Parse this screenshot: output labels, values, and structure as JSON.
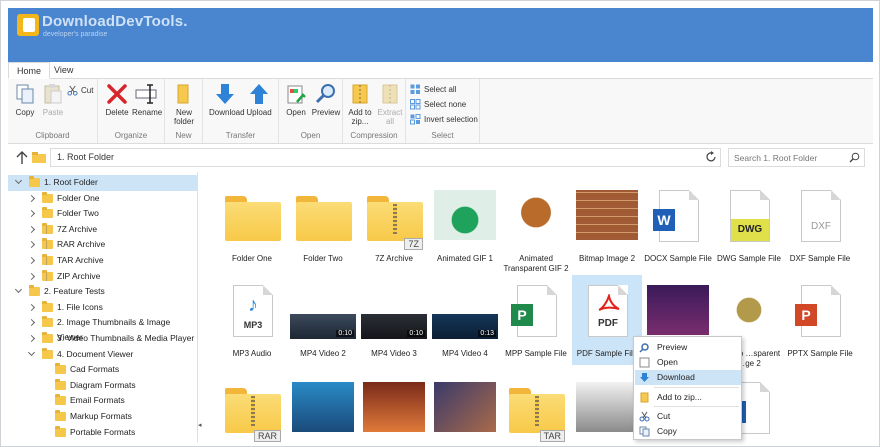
{
  "brand": {
    "name": "DownloadDevTools.",
    "tagline": "developer's paradise"
  },
  "tabs": [
    {
      "label": "Home"
    },
    {
      "label": "View"
    }
  ],
  "ribbon": {
    "groups": [
      {
        "label": "Clipboard",
        "buttons": [
          {
            "label": "Copy",
            "icon": "copy-icon"
          },
          {
            "label": "Paste",
            "icon": "paste-icon",
            "disabled": true
          },
          {
            "label": "Cut",
            "icon": "cut-icon"
          }
        ]
      },
      {
        "label": "Organize",
        "buttons": [
          {
            "label": "Delete",
            "icon": "delete-icon"
          },
          {
            "label": "Rename",
            "icon": "rename-icon"
          }
        ]
      },
      {
        "label": "New",
        "buttons": [
          {
            "label": "New folder",
            "icon": "new-folder-icon"
          }
        ]
      },
      {
        "label": "Transfer",
        "buttons": [
          {
            "label": "Download",
            "icon": "download-icon"
          },
          {
            "label": "Upload",
            "icon": "upload-icon"
          }
        ]
      },
      {
        "label": "Open",
        "buttons": [
          {
            "label": "Open",
            "icon": "open-icon"
          },
          {
            "label": "Preview",
            "icon": "preview-icon"
          }
        ]
      },
      {
        "label": "Compression",
        "buttons": [
          {
            "label": "Add to zip...",
            "icon": "add-zip-icon"
          },
          {
            "label": "Extract all",
            "icon": "extract-icon",
            "disabled": true
          }
        ]
      },
      {
        "label": "Select",
        "buttons": [
          {
            "label": "Select all",
            "icon": "select-all-icon"
          },
          {
            "label": "Select none",
            "icon": "select-none-icon"
          },
          {
            "label": "Invert selection",
            "icon": "invert-selection-icon"
          }
        ]
      }
    ]
  },
  "address": {
    "path": "1. Root Folder",
    "search_placeholder": "Search 1. Root Folder"
  },
  "tree": [
    {
      "label": "1. Root Folder",
      "level": 0,
      "expanded": true,
      "selected": true
    },
    {
      "label": "Folder One",
      "level": 1
    },
    {
      "label": "Folder Two",
      "level": 1
    },
    {
      "label": "7Z Archive",
      "level": 1,
      "zip": true
    },
    {
      "label": "RAR Archive",
      "level": 1,
      "zip": true
    },
    {
      "label": "TAR Archive",
      "level": 1,
      "zip": true
    },
    {
      "label": "ZIP Archive",
      "level": 1,
      "zip": true
    },
    {
      "label": "2. Feature Tests",
      "level": 0,
      "expanded": true
    },
    {
      "label": "1. File Icons",
      "level": 1
    },
    {
      "label": "2. Image Thumbnails & Image Viewer",
      "level": 1
    },
    {
      "label": "3. Video Thumbnails & Media Player",
      "level": 1
    },
    {
      "label": "4. Document Viewer",
      "level": 1,
      "expanded": true
    },
    {
      "label": "Cad Formats",
      "level": 2,
      "leaf": true
    },
    {
      "label": "Diagram Formats",
      "level": 2,
      "leaf": true
    },
    {
      "label": "Email Formats",
      "level": 2,
      "leaf": true
    },
    {
      "label": "Markup Formats",
      "level": 2,
      "leaf": true
    },
    {
      "label": "Portable Formats",
      "level": 2,
      "leaf": true
    }
  ],
  "items": [
    {
      "label": "Folder One",
      "kind": "folder"
    },
    {
      "label": "Folder Two",
      "kind": "folder"
    },
    {
      "label": "7Z Archive",
      "kind": "archive",
      "tag": "7Z"
    },
    {
      "label": "Animated GIF 1",
      "kind": "image"
    },
    {
      "label": "Animated Transparent GIF 2",
      "kind": "image"
    },
    {
      "label": "Bitmap Image 2",
      "kind": "image"
    },
    {
      "label": "DOCX Sample File",
      "kind": "doc",
      "badge": "W"
    },
    {
      "label": "DWG Sample File",
      "kind": "doc",
      "badge": "DWG"
    },
    {
      "label": "DXF Sample File",
      "kind": "doc",
      "badge": "DXF"
    },
    {
      "label": "MP3 Audio",
      "kind": "doc",
      "badge": "MP3"
    },
    {
      "label": "MP4 Video 2",
      "kind": "video",
      "time": "0:10"
    },
    {
      "label": "MP4 Video 3",
      "kind": "video",
      "time": "0:10"
    },
    {
      "label": "MP4 Video 4",
      "kind": "video",
      "time": "0:13"
    },
    {
      "label": "MPP Sample File",
      "kind": "doc",
      "badge": "P"
    },
    {
      "label": "PDF Sample File",
      "kind": "doc",
      "badge": "PDF",
      "selected": true
    },
    {
      "label": "",
      "kind": "image"
    },
    {
      "label": "…shop …sparent …ge 2",
      "kind": "image"
    },
    {
      "label": "PPTX Sample File",
      "kind": "doc",
      "badge": "P"
    },
    {
      "label": "",
      "kind": "archive",
      "tag": "RAR"
    },
    {
      "label": "",
      "kind": "image"
    },
    {
      "label": "",
      "kind": "image"
    },
    {
      "label": "",
      "kind": "image"
    },
    {
      "label": "",
      "kind": "archive",
      "tag": "TAR"
    },
    {
      "label": "",
      "kind": "image"
    },
    {
      "label": "",
      "kind": "doc"
    },
    {
      "label": "",
      "kind": "doc",
      "badge": "V"
    }
  ],
  "context_menu": [
    {
      "label": "Preview",
      "icon": "preview-icon"
    },
    {
      "label": "Open",
      "icon": "open-icon"
    },
    {
      "label": "Download",
      "icon": "download-icon",
      "highlighted": true
    },
    {
      "label": "Add to zip...",
      "icon": "add-zip-icon"
    },
    {
      "label": "Cut",
      "icon": "cut-icon"
    },
    {
      "label": "Copy",
      "icon": "copy-icon"
    }
  ],
  "colors": {
    "header": "#4a86d0",
    "accent": "#2e7fd6",
    "selection": "#cde4f7"
  }
}
